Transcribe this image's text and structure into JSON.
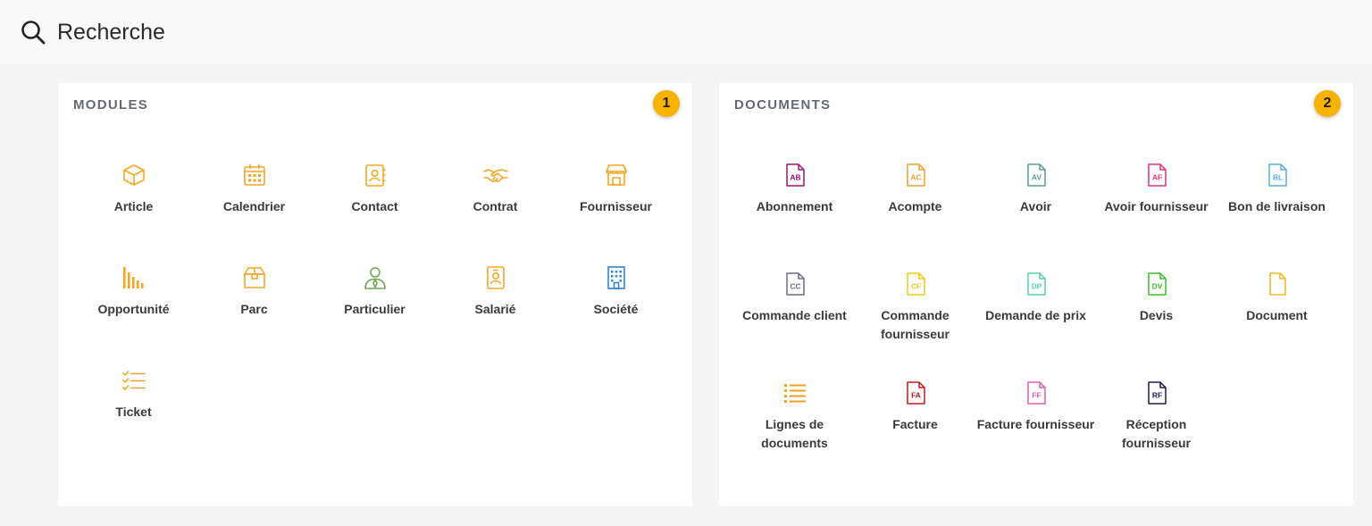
{
  "search": {
    "placeholder": "Recherche",
    "icon": "search-icon"
  },
  "modules": {
    "title": "MODULES",
    "badge": "1",
    "items": [
      {
        "label": "Article",
        "icon": "box-icon"
      },
      {
        "label": "Calendrier",
        "icon": "calendar-icon"
      },
      {
        "label": "Contact",
        "icon": "contact-book-icon"
      },
      {
        "label": "Contrat",
        "icon": "handshake-icon"
      },
      {
        "label": "Fournisseur",
        "icon": "store-icon"
      },
      {
        "label": "Opportunité",
        "icon": "bar-chart-icon"
      },
      {
        "label": "Parc",
        "icon": "package-icon"
      },
      {
        "label": "Particulier",
        "icon": "person-icon"
      },
      {
        "label": "Salarié",
        "icon": "badge-icon"
      },
      {
        "label": "Société",
        "icon": "building-icon"
      },
      {
        "label": "Ticket",
        "icon": "checklist-icon"
      }
    ]
  },
  "documents": {
    "title": "DOCUMENTS",
    "badge": "2",
    "items": [
      {
        "label": "Abonnement",
        "code": "AB",
        "color": "#a0126e"
      },
      {
        "label": "Acompte",
        "code": "AC",
        "color": "#f0a030"
      },
      {
        "label": "Avoir",
        "code": "AV",
        "color": "#5e9e8e"
      },
      {
        "label": "Avoir fournisseur",
        "code": "AF",
        "color": "#e0327a"
      },
      {
        "label": "Bon de livraison",
        "code": "BL",
        "color": "#5aaee0"
      },
      {
        "label": "Commande client",
        "code": "CC",
        "color": "#6a6a8a"
      },
      {
        "label": "Commande fournisseur",
        "code": "CF",
        "color": "#f2c818"
      },
      {
        "label": "Demande de prix",
        "code": "DP",
        "color": "#5ad4a0"
      },
      {
        "label": "Devis",
        "code": "DV",
        "color": "#3cc028"
      },
      {
        "label": "Document",
        "code": "",
        "color": "#f5b82e"
      },
      {
        "label": "Lignes de documents",
        "code": "",
        "color": "#f0a020"
      },
      {
        "label": "Facture",
        "code": "FA",
        "color": "#c81818"
      },
      {
        "label": "Facture fournisseur",
        "code": "FF",
        "color": "#e85ab0"
      },
      {
        "label": "Réception fournisseur",
        "code": "RF",
        "color": "#1a1a5e"
      }
    ]
  },
  "colors": {
    "module_icon": "#f5a623",
    "particulier_icon": "#6aa84f",
    "societe_icon": "#2f86d6",
    "badge": "#f7b300"
  }
}
